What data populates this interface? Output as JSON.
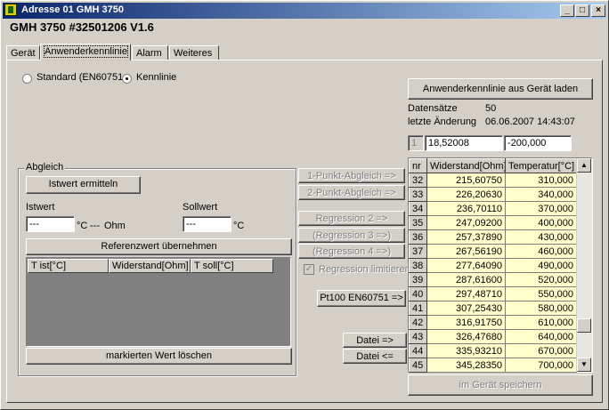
{
  "window": {
    "title": "Adresse 01 GMH 3750",
    "device_title": "GMH 3750 #32501206 V1.6",
    "minimize": "_",
    "maximize": "□",
    "close": "×"
  },
  "tabs": [
    "Gerät",
    "Anwenderkennlinie",
    "Alarm",
    "Weiteres"
  ],
  "active_tab": "Anwenderkennlinie",
  "mode": {
    "standard_label": "Standard (EN60751",
    "kennlinie_label": "Kennlinie",
    "selected": "Kennlinie"
  },
  "load_button": "Anwenderkennlinie aus Gerät laden",
  "info": {
    "datensaetze_label": "Datensätze",
    "datensaetze_value": "50",
    "aenderung_label": "letzte Änderung",
    "aenderung_value": "06.06.2007 14:43:07"
  },
  "edit_row": {
    "index": "1",
    "widerstand": "18,52008",
    "temperatur": "-200,000"
  },
  "abgleich": {
    "group_title": "Abgleich",
    "istwert_button": "Istwert ermitteln",
    "istwert_label": "Istwert",
    "sollwert_label": "Sollwert",
    "istwert_value": "---",
    "istwert_unit": "°C",
    "ohm_value": "---",
    "ohm_unit": "Ohm",
    "sollwert_value": "---",
    "sollwert_unit": "°C",
    "referenz_button": "Referenzwert übernehmen",
    "columns": [
      "T ist[°C]",
      "Widerstand[Ohm]",
      "T soll[°C]"
    ],
    "loeschen_button": "markierten Wert löschen"
  },
  "middle": {
    "punkt1": "1-Punkt-Abgleich =>",
    "punkt2": "2-Punkt-Abgleich =>",
    "regression2": "Regression 2 =>",
    "regression3": "(Regression 3 =>)",
    "regression4": "(Regression 4 =>)",
    "limit_label": "Regression limitieren",
    "limit_checked": true,
    "pt100": "Pt100 EN60751 =>",
    "datei_out": "Datei =>",
    "datei_in": "Datei <="
  },
  "table": {
    "headers": [
      "nr",
      "Widerstand[Ohm]",
      "Temperatur[°C]"
    ],
    "rows": [
      {
        "nr": "32",
        "widerstand": "215,60750",
        "temperatur": "310,000"
      },
      {
        "nr": "33",
        "widerstand": "226,20630",
        "temperatur": "340,000"
      },
      {
        "nr": "34",
        "widerstand": "236,70110",
        "temperatur": "370,000"
      },
      {
        "nr": "35",
        "widerstand": "247,09200",
        "temperatur": "400,000"
      },
      {
        "nr": "36",
        "widerstand": "257,37890",
        "temperatur": "430,000"
      },
      {
        "nr": "37",
        "widerstand": "267,56190",
        "temperatur": "460,000"
      },
      {
        "nr": "38",
        "widerstand": "277,64090",
        "temperatur": "490,000"
      },
      {
        "nr": "39",
        "widerstand": "287,61600",
        "temperatur": "520,000"
      },
      {
        "nr": "40",
        "widerstand": "297,48710",
        "temperatur": "550,000"
      },
      {
        "nr": "41",
        "widerstand": "307,25430",
        "temperatur": "580,000"
      },
      {
        "nr": "42",
        "widerstand": "316,91750",
        "temperatur": "610,000"
      },
      {
        "nr": "43",
        "widerstand": "326,47680",
        "temperatur": "640,000"
      },
      {
        "nr": "44",
        "widerstand": "335,93210",
        "temperatur": "670,000"
      },
      {
        "nr": "45",
        "widerstand": "345,28350",
        "temperatur": "700,000"
      }
    ]
  },
  "save_button": "im Gerät speichern",
  "colors": {
    "title_bar": "#0a246a",
    "face": "#d4d0c8",
    "cell_fill": "#ffffcc",
    "list_bg": "#808080"
  }
}
